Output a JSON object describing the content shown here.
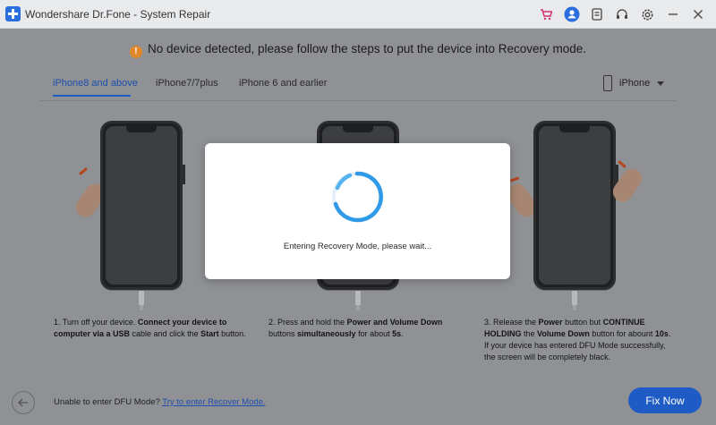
{
  "window": {
    "title": "Wondershare Dr.Fone - System Repair",
    "icons": [
      "cart-icon",
      "user-avatar-icon",
      "document-icon",
      "headset-icon",
      "gear-icon",
      "minimize-icon",
      "close-icon"
    ]
  },
  "notice": {
    "text": "No device detected, please follow the steps to put the device into Recovery mode.",
    "icon": "warning-icon",
    "color": "#e0872a"
  },
  "tabs": [
    {
      "label": "iPhone8 and above",
      "active": true
    },
    {
      "label": "iPhone7/7plus",
      "active": false
    },
    {
      "label": "iPhone 6 and earlier",
      "active": false
    }
  ],
  "device_select": {
    "value": "iPhone"
  },
  "steps": [
    {
      "p1": "1. Turn off your device. ",
      "b1": "Connect your device to computer via a USB",
      "p2": " cable and click the ",
      "b2": "Start",
      "p3": " button."
    },
    {
      "p1": "2. Press and hold the ",
      "b1": "Power and Volume Down",
      "p2": " buttons ",
      "b2": "simultaneously",
      "p3": " for about ",
      "b3": "5s",
      "p4": "."
    },
    {
      "p1": "3. Release the ",
      "b1": "Power",
      "p2": " button but ",
      "b2": "CONTINUE HOLDING",
      "p3": " the ",
      "b3": "Volume Down",
      "p4": " button for abount ",
      "b4": "10s",
      "p5": ". If your device has entered DFU Mode successfully, the screen will be completely black."
    }
  ],
  "bottom": {
    "text": "Unable to enter DFU Mode? ",
    "link": "Try to enter Recover Mode.",
    "fix_button": "Fix Now"
  },
  "modal": {
    "text": "Entering Recovery Mode, please wait..."
  },
  "colors": {
    "accent": "#1e5bc4",
    "tab_active": "#1d4fae",
    "warning": "#e0872a"
  }
}
